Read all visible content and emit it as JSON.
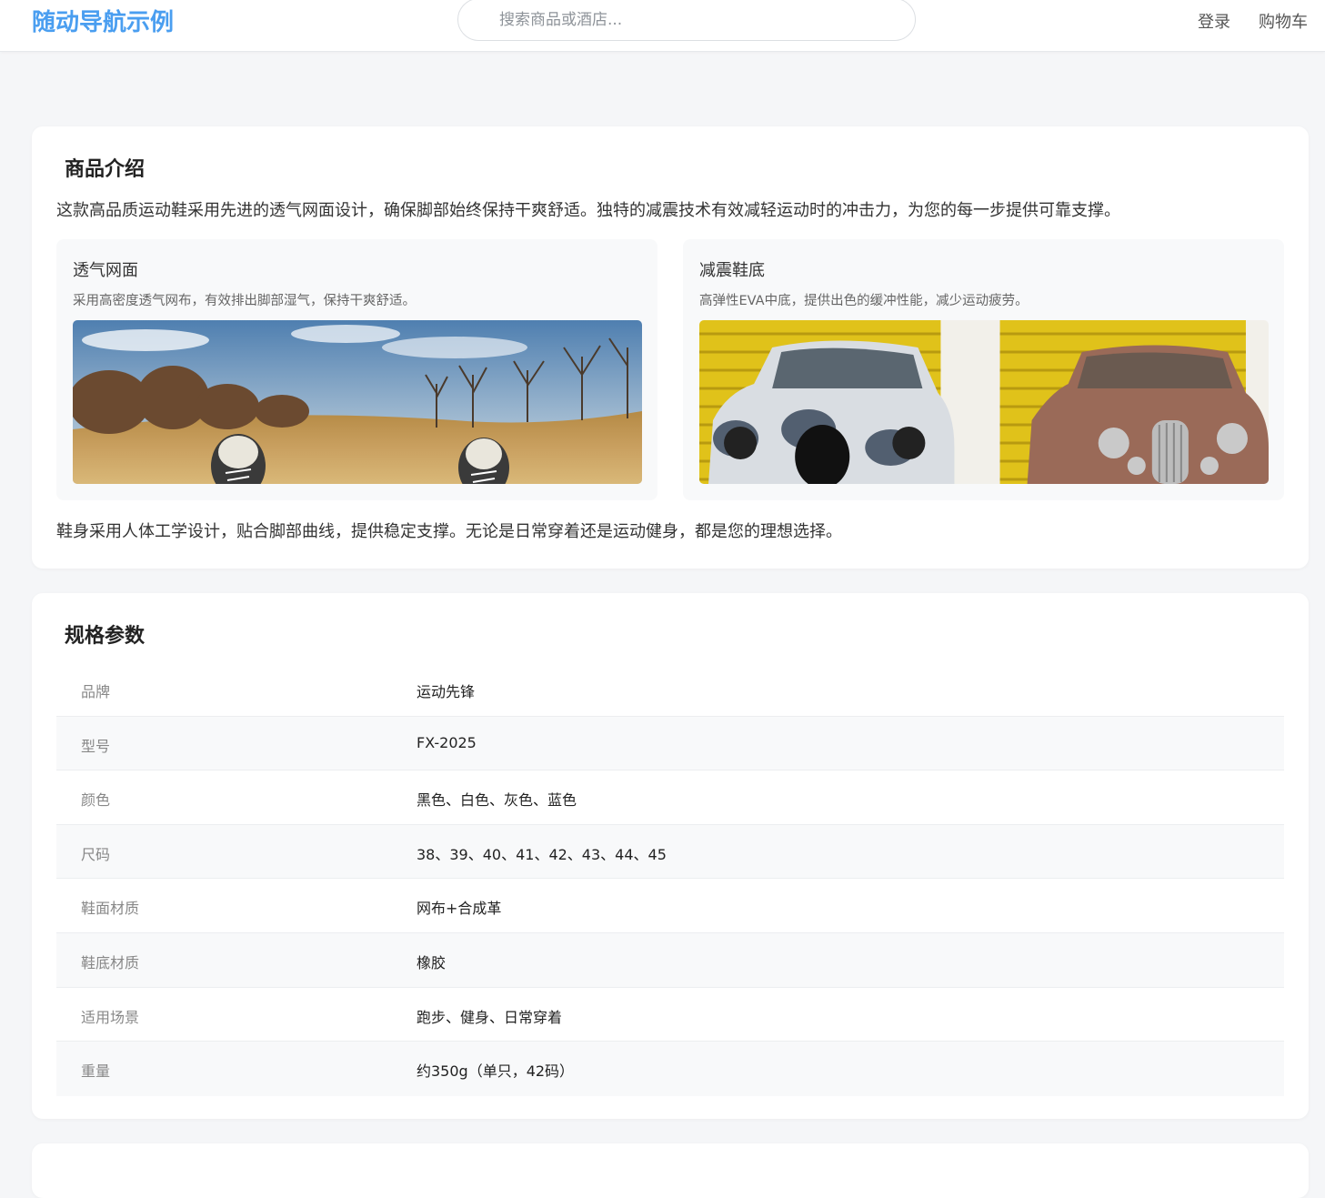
{
  "header": {
    "logo": "随动导航示例",
    "search_placeholder": "搜索商品或酒店...",
    "nav": {
      "login": "登录",
      "cart": "购物车"
    }
  },
  "intro": {
    "title": "商品介绍",
    "text": "这款高品质运动鞋采用先进的透气网面设计，确保脚部始终保持干爽舒适。独特的减震技术有效减轻运动时的冲击力，为您的每一步提供可靠支撑。",
    "features": [
      {
        "title": "透气网面",
        "desc": "采用高密度透气网布，有效排出脚部湿气，保持干爽舒适。",
        "image": "sneakers-on-grass-field-photo"
      },
      {
        "title": "减震鞋底",
        "desc": "高弹性EVA中底，提供出色的缓冲性能，减少运动疲劳。",
        "image": "two-vintage-cars-yellow-wall-photo"
      }
    ],
    "outro": "鞋身采用人体工学设计，贴合脚部曲线，提供稳定支撑。无论是日常穿着还是运动健身，都是您的理想选择。"
  },
  "specs": {
    "title": "规格参数",
    "rows": [
      {
        "key": "品牌",
        "value": "运动先锋"
      },
      {
        "key": "型号",
        "value": "FX-2025"
      },
      {
        "key": "颜色",
        "value": "黑色、白色、灰色、蓝色"
      },
      {
        "key": "尺码",
        "value": "38、39、40、41、42、43、44、45"
      },
      {
        "key": "鞋面材质",
        "value": "网布+合成革"
      },
      {
        "key": "鞋底材质",
        "value": "橡胶"
      },
      {
        "key": "适用场景",
        "value": "跑步、健身、日常穿着"
      },
      {
        "key": "重量",
        "value": "约350g（单只，42码）"
      }
    ]
  },
  "colors": {
    "brand": "#4a9ef0",
    "background": "#f5f6f8",
    "card": "#ffffff"
  }
}
